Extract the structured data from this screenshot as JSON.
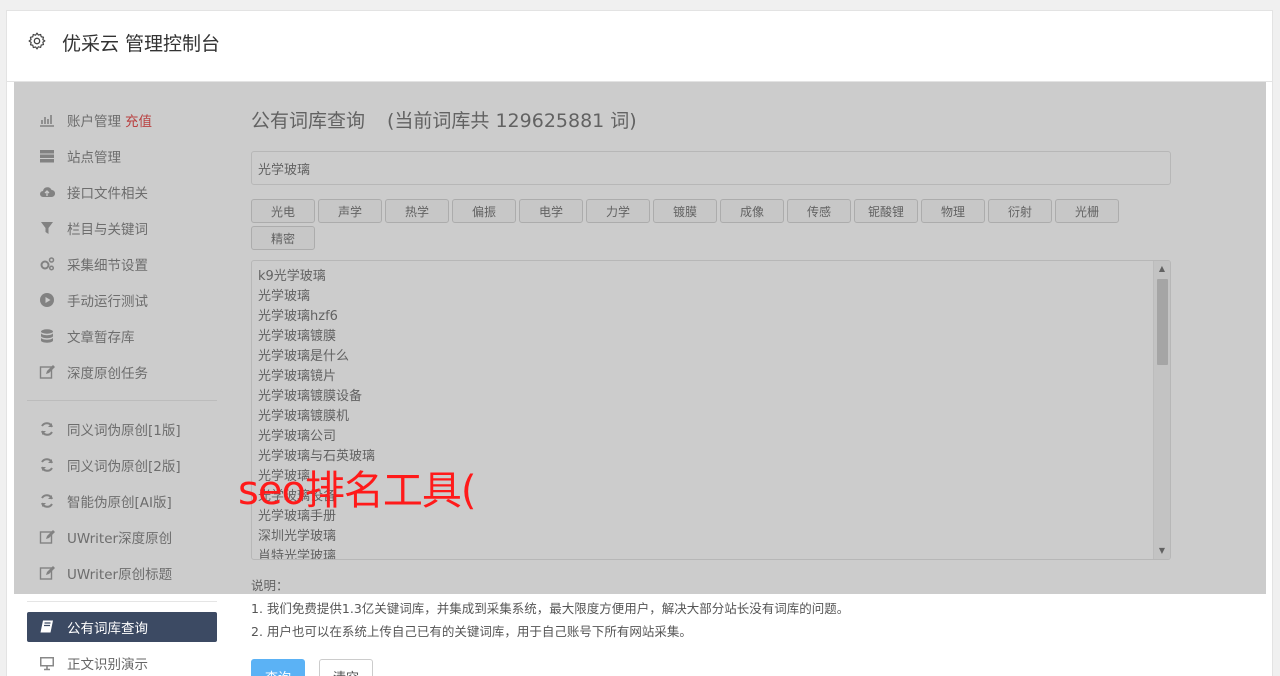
{
  "header": {
    "title": "优采云 管理控制台",
    "icon": "gear-icon"
  },
  "sidebar": {
    "items": [
      {
        "label": "账户管理",
        "extra": "充值",
        "icon": "bar-chart-icon"
      },
      {
        "label": "站点管理",
        "icon": "server-icon"
      },
      {
        "label": "接口文件相关",
        "icon": "cloud-upload-icon"
      },
      {
        "label": "栏目与关键词",
        "icon": "filter-icon"
      },
      {
        "label": "采集细节设置",
        "icon": "cogs-icon"
      },
      {
        "label": "手动运行测试",
        "icon": "play-circle-icon"
      },
      {
        "label": "文章暂存库",
        "icon": "database-icon"
      },
      {
        "label": "深度原创任务",
        "icon": "edit-icon"
      }
    ],
    "items2": [
      {
        "label": "同义词伪原创[1版]",
        "icon": "refresh-icon"
      },
      {
        "label": "同义词伪原创[2版]",
        "icon": "refresh-icon"
      },
      {
        "label": "智能伪原创[AI版]",
        "icon": "refresh-icon"
      },
      {
        "label": "UWriter深度原创",
        "icon": "edit-icon"
      },
      {
        "label": "UWriter原创标题",
        "icon": "edit-icon"
      }
    ],
    "items3": [
      {
        "label": "公有词库查询",
        "icon": "book-icon",
        "active": true
      },
      {
        "label": "正文识别演示",
        "icon": "monitor-icon"
      }
    ]
  },
  "main": {
    "title": "公有词库查询",
    "count_text": "(当前词库共 129625881 词)",
    "search_value": "光学玻璃",
    "tags": [
      "光电",
      "声学",
      "热学",
      "偏振",
      "电学",
      "力学",
      "镀膜",
      "成像",
      "传感",
      "铌酸锂",
      "物理",
      "衍射",
      "光栅",
      "精密"
    ],
    "results": [
      "k9光学玻璃",
      "光学玻璃",
      "光学玻璃hzf6",
      "光学玻璃镀膜",
      "光学玻璃是什么",
      "光学玻璃镜片",
      "光学玻璃镀膜设备",
      "光学玻璃镀膜机",
      "光学玻璃公司",
      "光学玻璃与石英玻璃",
      "光学玻璃",
      "光学玻璃设备",
      "光学玻璃手册",
      "深圳光学玻璃",
      "肖特光学玻璃"
    ],
    "notes_title": "说明：",
    "notes": [
      "1. 我们免费提供1.3亿关键词库，并集成到采集系统，最大限度方便用户，解决大部分站长没有词库的问题。",
      "2. 用户也可以在系统上传自己已有的关键词库，用于自己账号下所有网站采集。"
    ],
    "query_button": "查询",
    "clear_button": "清空"
  },
  "watermark": "seo排名工具("
}
